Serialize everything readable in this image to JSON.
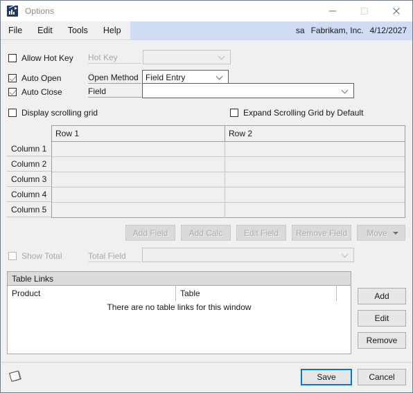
{
  "window": {
    "title": "Options",
    "icon": "chart-app-icon",
    "controls": {
      "minimize": "─",
      "maximize": "□",
      "close": "✕"
    }
  },
  "menubar": {
    "items": [
      {
        "label": "File"
      },
      {
        "label": "Edit"
      },
      {
        "label": "Tools"
      },
      {
        "label": "Help"
      }
    ],
    "status": {
      "user": "sa",
      "company": "Fabrikam, Inc.",
      "date": "4/12/2027"
    }
  },
  "options": {
    "allow_hot_key": {
      "label": "Allow Hot Key",
      "checked": false
    },
    "hot_key": {
      "label": "Hot Key",
      "value": "",
      "disabled": true
    },
    "auto_open": {
      "label": "Auto Open",
      "checked": true
    },
    "auto_close": {
      "label": "Auto Close",
      "checked": true
    },
    "open_method": {
      "label": "Open Method",
      "value": "Field Entry"
    },
    "field": {
      "label": "Field",
      "value": ""
    },
    "display_scrolling_grid": {
      "label": "Display scrolling grid",
      "checked": false
    },
    "expand_scrolling_grid": {
      "label": "Expand Scrolling Grid by Default",
      "checked": false
    }
  },
  "grid": {
    "columns": [
      "Row 1",
      "Row 2"
    ],
    "row_labels": [
      "Column 1",
      "Column 2",
      "Column 3",
      "Column 4",
      "Column 5"
    ],
    "cells": [
      [
        "",
        ""
      ],
      [
        "",
        ""
      ],
      [
        "",
        ""
      ],
      [
        "",
        ""
      ],
      [
        "",
        ""
      ]
    ]
  },
  "field_buttons": [
    {
      "label": "Add Field",
      "disabled": true
    },
    {
      "label": "Add Calc",
      "disabled": true
    },
    {
      "label": "Edit Field",
      "disabled": true
    },
    {
      "label": "Remove Field",
      "disabled": true
    },
    {
      "label": "Move",
      "disabled": true,
      "has_dropdown": true
    }
  ],
  "total": {
    "show_total": {
      "label": "Show Total",
      "checked": false,
      "disabled": true
    },
    "total_field": {
      "label": "Total Field",
      "value": "",
      "disabled": true
    }
  },
  "table_links": {
    "group_title": "Table Links",
    "columns": [
      "Product",
      "Table",
      ""
    ],
    "empty_message": "There are no table links for this window",
    "rows": [],
    "buttons": [
      {
        "label": "Add"
      },
      {
        "label": "Edit"
      },
      {
        "label": "Remove"
      }
    ]
  },
  "footer": {
    "note_icon": "note-icon",
    "save": {
      "label": "Save",
      "focused": true
    },
    "cancel": {
      "label": "Cancel"
    }
  },
  "colors": {
    "accent": "#0078d7",
    "status_bar": "#cfdcf3",
    "window_bg": "#f0f0f0",
    "icon_blue": "#1f3864"
  }
}
